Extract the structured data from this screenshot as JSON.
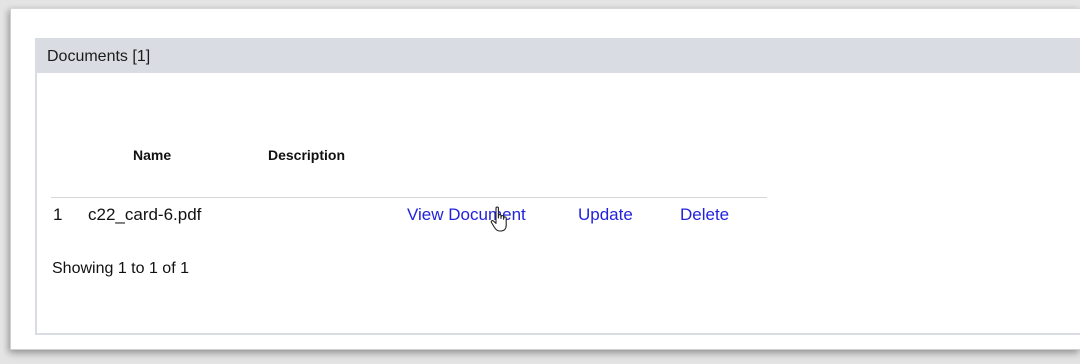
{
  "panel": {
    "title": "Documents [1]"
  },
  "table": {
    "columns": [
      "Name",
      "Description"
    ],
    "rows": [
      {
        "index": "1",
        "name": "c22_card-6.pdf",
        "description": "",
        "actions": {
          "view": "View Document",
          "update": "Update",
          "delete": "Delete"
        }
      }
    ]
  },
  "pagination": {
    "summary": "Showing 1 to 1 of 1"
  },
  "colors": {
    "header_bg": "#d9dce3",
    "link": "#2222dd"
  },
  "icons": {
    "cursor": "hand-pointer-icon"
  }
}
